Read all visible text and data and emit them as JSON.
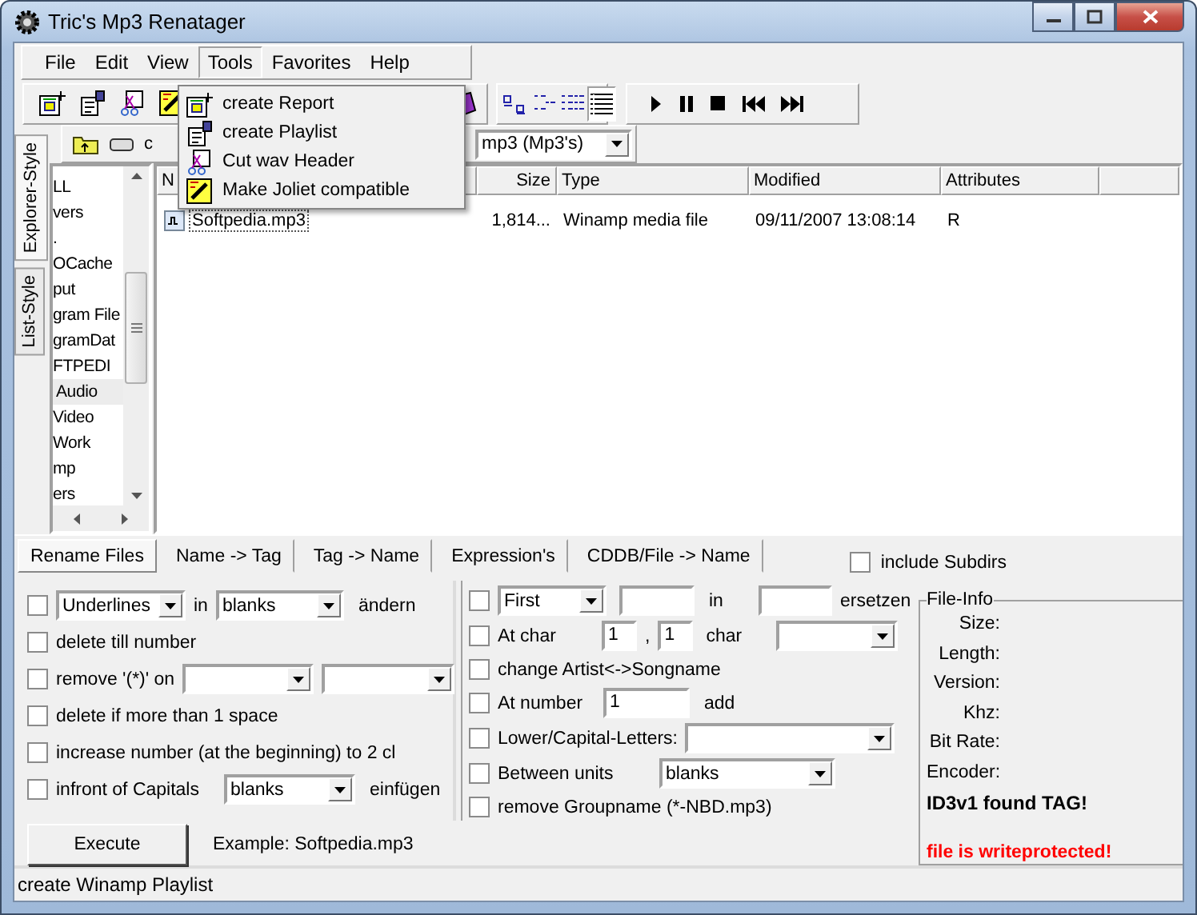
{
  "window": {
    "title": "Tric's Mp3 Renatager"
  },
  "menu": [
    {
      "label": "File",
      "selected": false
    },
    {
      "label": "Edit",
      "selected": false
    },
    {
      "label": "View",
      "selected": false
    },
    {
      "label": "Tools",
      "selected": true
    },
    {
      "label": "Favorites",
      "selected": false
    },
    {
      "label": "Help",
      "selected": false
    }
  ],
  "tools_menu": [
    {
      "label": "create Report",
      "kind": "report"
    },
    {
      "label": "create Playlist",
      "kind": "playlist"
    },
    {
      "label": "Cut wav Header",
      "kind": "cut"
    },
    {
      "label": "Make Joliet compatible",
      "kind": "joliet"
    }
  ],
  "view_modes": [
    {
      "kind": "large",
      "selected": false
    },
    {
      "kind": "small",
      "selected": false
    },
    {
      "kind": "list",
      "selected": false
    },
    {
      "kind": "details",
      "selected": true
    }
  ],
  "drive_bar": {
    "drive": "c",
    "filter": "mp3 (Mp3's)"
  },
  "side_tabs": [
    {
      "label": "Explorer-Style",
      "selected": true
    },
    {
      "label": "List-Style",
      "selected": false
    }
  ],
  "folders": [
    {
      "label": "LL",
      "selected": false
    },
    {
      "label": "vers",
      "selected": false
    },
    {
      "label": ".",
      "selected": false
    },
    {
      "label": "OCache",
      "selected": false
    },
    {
      "label": "put",
      "selected": false
    },
    {
      "label": "gram File",
      "selected": false
    },
    {
      "label": "gramDat",
      "selected": false
    },
    {
      "label": "FTPEDI",
      "selected": false
    },
    {
      "label": "Audio",
      "selected": true
    },
    {
      "label": "Video",
      "selected": false
    },
    {
      "label": "Work",
      "selected": false
    },
    {
      "label": "mp",
      "selected": false
    },
    {
      "label": "ers",
      "selected": false
    }
  ],
  "file_list": {
    "columns": [
      "N",
      "Size",
      "Type",
      "Modified",
      "Attributes"
    ],
    "rows": [
      {
        "name": "Softpedia.mp3",
        "size": "1,814...",
        "type": "Winamp media file",
        "modified": "09/11/2007 13:08:14",
        "attributes": "R"
      }
    ]
  },
  "tabs": [
    {
      "label": "Rename Files",
      "selected": true
    },
    {
      "label": "Name -> Tag",
      "selected": false
    },
    {
      "label": "Tag -> Name",
      "selected": false
    },
    {
      "label": "Expression's",
      "selected": false
    },
    {
      "label": "CDDB/File -> Name",
      "selected": false
    }
  ],
  "include_subdirs": {
    "label": "include Subdirs",
    "checked": false
  },
  "left_options": [
    {
      "kind": "replace",
      "checked": false,
      "from": "Underlines",
      "joiner": "in",
      "to": "blanks",
      "action": "ändern"
    },
    {
      "kind": "plain",
      "checked": false,
      "label": "delete till number"
    },
    {
      "kind": "remove",
      "checked": false,
      "label": "remove '(*)' on"
    },
    {
      "kind": "plain",
      "checked": false,
      "label": "delete if more than 1 space"
    },
    {
      "kind": "plain",
      "checked": false,
      "label": "increase number (at the beginning) to 2 cl"
    },
    {
      "kind": "insert",
      "checked": false,
      "label": "infront of Capitals",
      "value": "blanks",
      "action": "einfügen"
    }
  ],
  "execute": {
    "label": "Execute",
    "example": "Example: Softpedia.mp3"
  },
  "middle_options": [
    {
      "kind": "replace",
      "checked": false,
      "value": "First",
      "joiner": "in",
      "action": "ersetzen"
    },
    {
      "kind": "at_char",
      "checked": false,
      "label": "At char",
      "start": "1",
      "separator": ",",
      "count": "1",
      "unit": "char"
    },
    {
      "kind": "plain",
      "checked": false,
      "label": "change Artist<->Songname"
    },
    {
      "kind": "at_number",
      "checked": false,
      "label": "At number",
      "value": "1",
      "action": "add"
    },
    {
      "kind": "case",
      "checked": false,
      "label": "Lower/Capital-Letters:"
    },
    {
      "kind": "between",
      "checked": false,
      "label": "Between units",
      "value": "blanks"
    },
    {
      "kind": "plain",
      "checked": false,
      "label": "remove Groupname (*-NBD.mp3)"
    }
  ],
  "file_info": {
    "title": "File-Info",
    "fields": [
      "Size:",
      "Length:",
      "Version:",
      "Khz:",
      "Bit Rate:",
      "Encoder:"
    ],
    "tag_status": "ID3v1 found TAG!",
    "warning": "file is writeprotected!"
  },
  "status_bar": "create Winamp Playlist"
}
